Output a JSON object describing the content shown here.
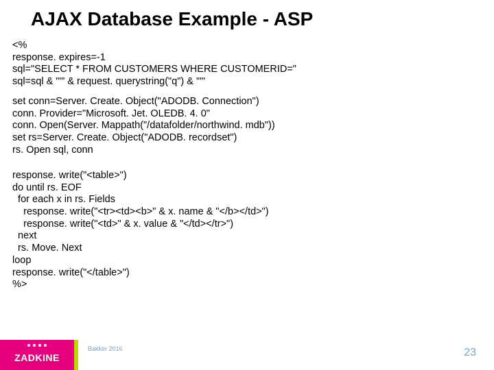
{
  "title": "AJAX Database Example - ASP",
  "code": {
    "block1": "<%\nresponse. expires=-1\nsql=\"SELECT * FROM CUSTOMERS WHERE CUSTOMERID=\"\nsql=sql & \"'\" & request. querystring(\"q\") & \"'\"",
    "block2": "set conn=Server. Create. Object(\"ADODB. Connection\")\nconn. Provider=\"Microsoft. Jet. OLEDB. 4. 0\"\nconn. Open(Server. Mappath(\"/datafolder/northwind. mdb\"))\nset rs=Server. Create. Object(\"ADODB. recordset\")\nrs. Open sql, conn",
    "block3": "response. write(\"<table>\")\ndo until rs. EOF\n  for each x in rs. Fields\n    response. write(\"<tr><td><b>\" & x. name & \"</b></td>\")\n    response. write(\"<td>\" & x. value & \"</td></tr>\")\n  next\n  rs. Move. Next\nloop\nresponse. write(\"</table>\")\n%>"
  },
  "footer": {
    "logo": "ZADKINE",
    "author": "Bakker 2016",
    "page": "23"
  }
}
